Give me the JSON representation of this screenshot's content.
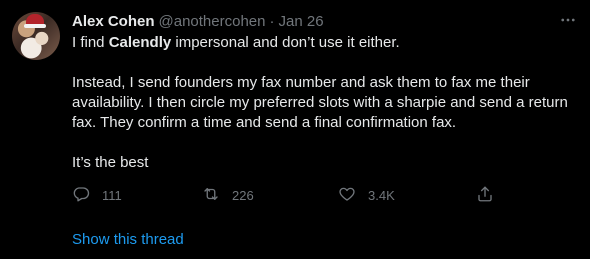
{
  "tweet": {
    "author_name": "Alex Cohen",
    "author_handle": "@anothercohen",
    "separator": "·",
    "date": "Jan 26",
    "paragraph1_prefix": "I find ",
    "paragraph1_bold": "Calendly",
    "paragraph1_suffix": " impersonal and don’t use it either.",
    "paragraph2": "Instead, I send founders my fax number and ask them to fax me their availability. I then circle my preferred slots with a sharpie and send a return fax. They confirm a time and send a final confirmation fax.",
    "paragraph3": "It’s the best"
  },
  "actions": {
    "reply_count": "111",
    "retweet_count": "226",
    "like_count": "3.4K",
    "reply_icon": "reply-icon",
    "retweet_icon": "retweet-icon",
    "like_icon": "heart-icon",
    "share_icon": "share-icon"
  },
  "footer": {
    "show_thread": "Show this thread"
  },
  "colors": {
    "background": "#000000",
    "text": "#e7e9ea",
    "muted": "#71767b",
    "link": "#1d9bf0"
  }
}
